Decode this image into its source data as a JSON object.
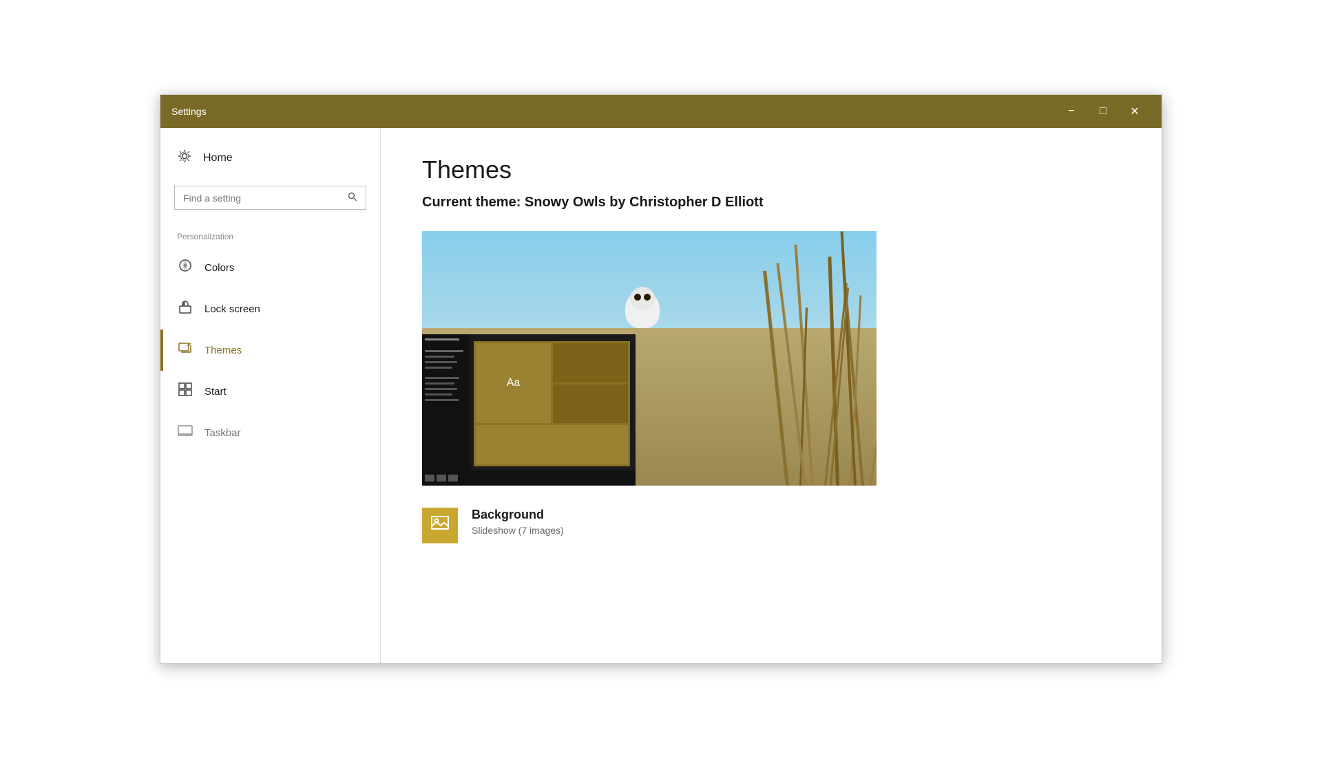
{
  "window": {
    "title": "Settings"
  },
  "titlebar": {
    "title": "Settings",
    "minimize_label": "−",
    "maximize_label": "□",
    "close_label": "✕"
  },
  "sidebar": {
    "home_label": "Home",
    "search_placeholder": "Find a setting",
    "section_label": "Personalization",
    "nav_items": [
      {
        "id": "colors",
        "label": "Colors",
        "active": false
      },
      {
        "id": "lock-screen",
        "label": "Lock screen",
        "active": false
      },
      {
        "id": "themes",
        "label": "Themes",
        "active": true
      },
      {
        "id": "start",
        "label": "Start",
        "active": false
      },
      {
        "id": "taskbar",
        "label": "Taskbar",
        "active": false
      }
    ]
  },
  "main": {
    "page_title": "Themes",
    "current_theme_label": "Current theme: Snowy Owls by Christopher D Elliott",
    "desktop_preview_aa": "Aa",
    "background_section": {
      "title": "Background",
      "subtitle": "Slideshow (7 images)"
    }
  }
}
